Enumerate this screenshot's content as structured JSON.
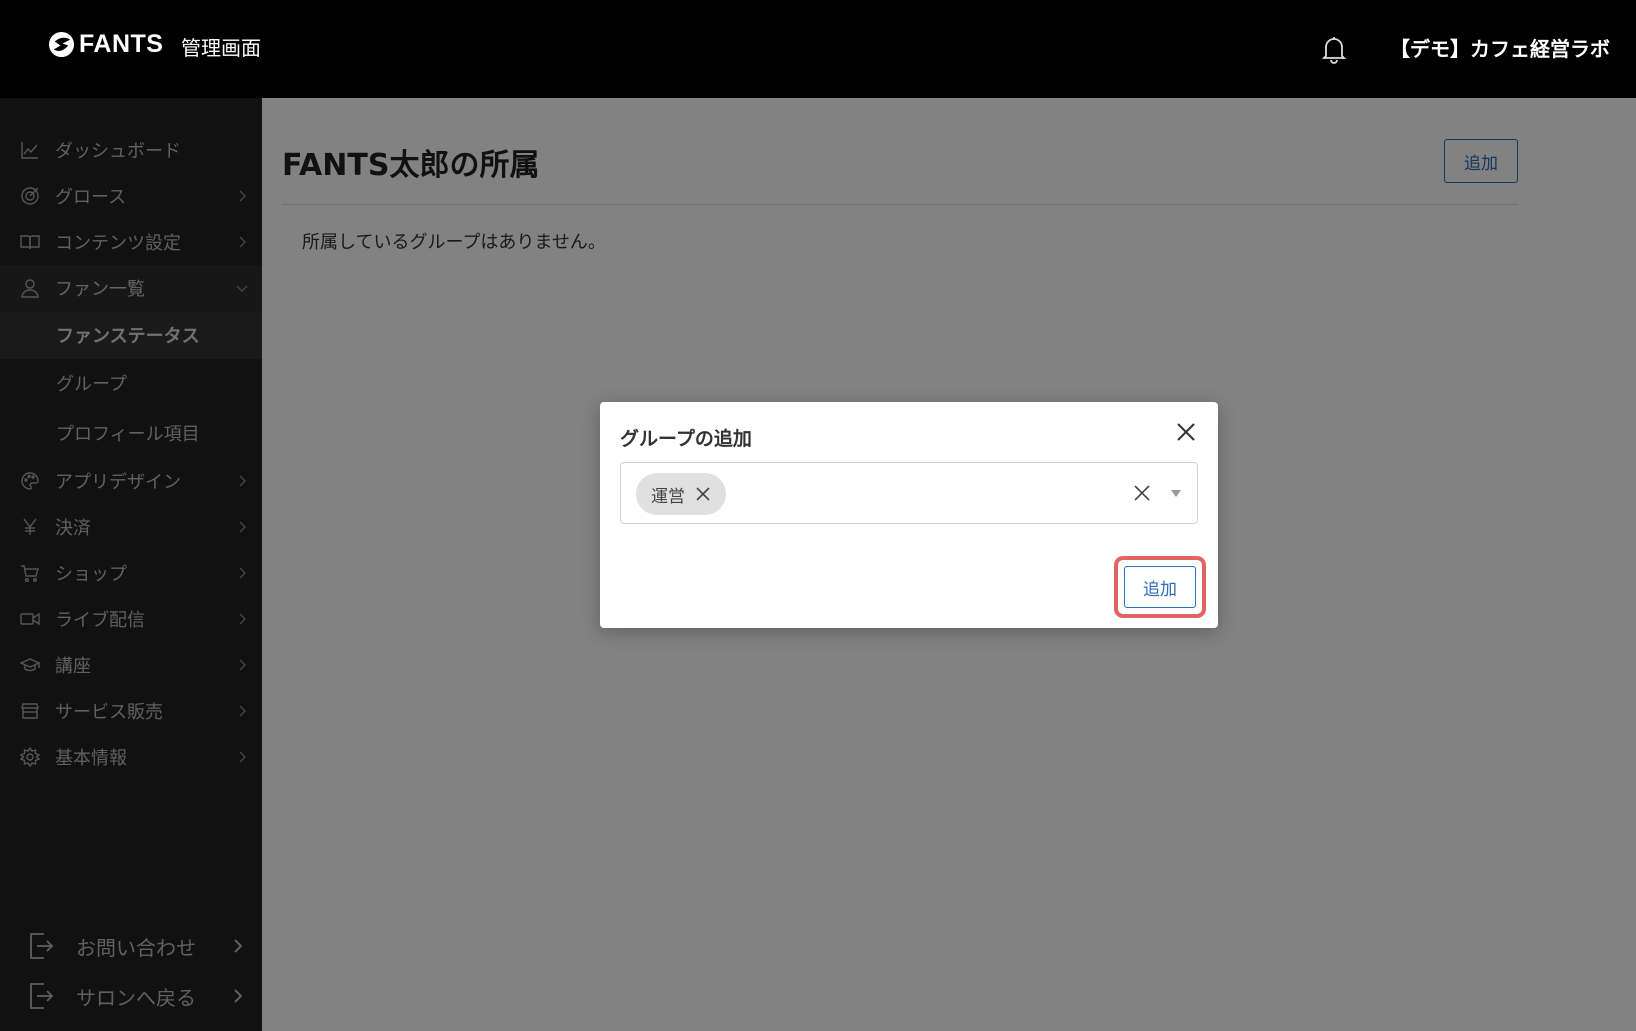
{
  "header": {
    "logo_text": "FANTS",
    "admin_label": "管理画面",
    "org_name": "【デモ】カフェ経営ラボ"
  },
  "sidebar": {
    "items": [
      {
        "label": "ダッシュボード",
        "icon": "chart-line-icon"
      },
      {
        "label": "グロース",
        "icon": "target-icon"
      },
      {
        "label": "コンテンツ設定",
        "icon": "book-icon"
      },
      {
        "label": "ファン一覧",
        "icon": "user-icon"
      },
      {
        "label": "アプリデザイン",
        "icon": "palette-icon"
      },
      {
        "label": "決済",
        "icon": "yen-icon"
      },
      {
        "label": "ショップ",
        "icon": "cart-icon"
      },
      {
        "label": "ライブ配信",
        "icon": "video-icon"
      },
      {
        "label": "講座",
        "icon": "graduation-cap-icon"
      },
      {
        "label": "サービス販売",
        "icon": "store-icon"
      },
      {
        "label": "基本情報",
        "icon": "gear-icon"
      }
    ],
    "sub_items": [
      {
        "label": "ファンステータス"
      },
      {
        "label": "グループ"
      },
      {
        "label": "プロフィール項目"
      }
    ],
    "footer": [
      {
        "label": "お問い合わせ",
        "icon": "exit-icon"
      },
      {
        "label": "サロンへ戻る",
        "icon": "exit-icon"
      }
    ]
  },
  "main": {
    "title": "FANTS太郎の所属",
    "add_label": "追加",
    "empty_message": "所属しているグループはありません。"
  },
  "modal": {
    "title": "グループの追加",
    "chip_label": "運営",
    "add_label": "追加"
  },
  "colors": {
    "accent": "#2c6fb5",
    "highlight": "#e06461",
    "sidebar_bg": "#222222",
    "header_bg": "#000000"
  }
}
